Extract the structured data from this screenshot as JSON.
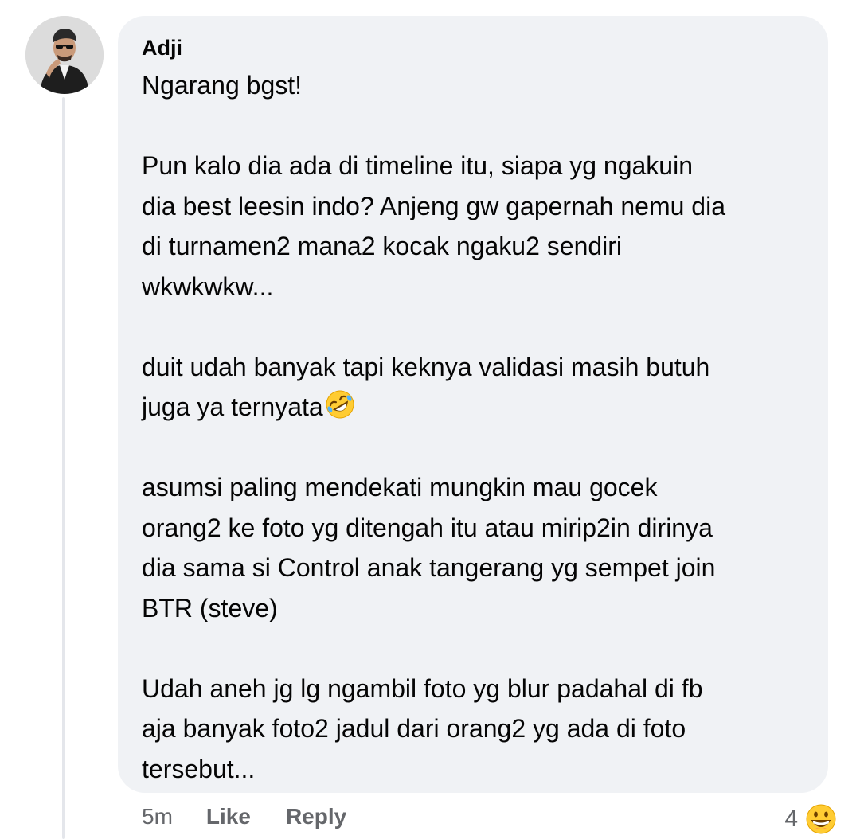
{
  "comment": {
    "author": "Adji",
    "paragraphs": [
      [
        "Ngarang bgst!"
      ],
      [
        "Pun kalo dia ada di timeline itu, siapa yg ngakuin",
        "dia best leesin indo? Anjeng gw gapernah nemu dia",
        "di turnamen2 mana2 kocak ngaku2 sendiri",
        "wkwkwkw..."
      ],
      [
        "duit udah banyak tapi keknya validasi masih butuh",
        "juga ya ternyata"
      ],
      [
        "asumsi paling mendekati mungkin mau gocek",
        "orang2 ke foto yg ditengah itu atau mirip2in dirinya",
        "dia sama si Control anak tangerang yg sempet join",
        "BTR (steve)"
      ],
      [
        "Udah aneh jg lg ngambil foto yg blur padahal di fb",
        "aja banyak foto2 jadul dari orang2 yg ada di foto",
        "tersebut..."
      ]
    ],
    "inline_emoji_icon": "rolling-on-floor-laughing-emoji",
    "time": "5m",
    "like_label": "Like",
    "reply_label": "Reply",
    "reaction_count": "4",
    "reaction_icon": "grinning-face-emoji"
  },
  "colors": {
    "bubble": "#f0f2f5",
    "text": "#050505",
    "muted": "#65676b",
    "thread_line": "#e4e6eb"
  }
}
